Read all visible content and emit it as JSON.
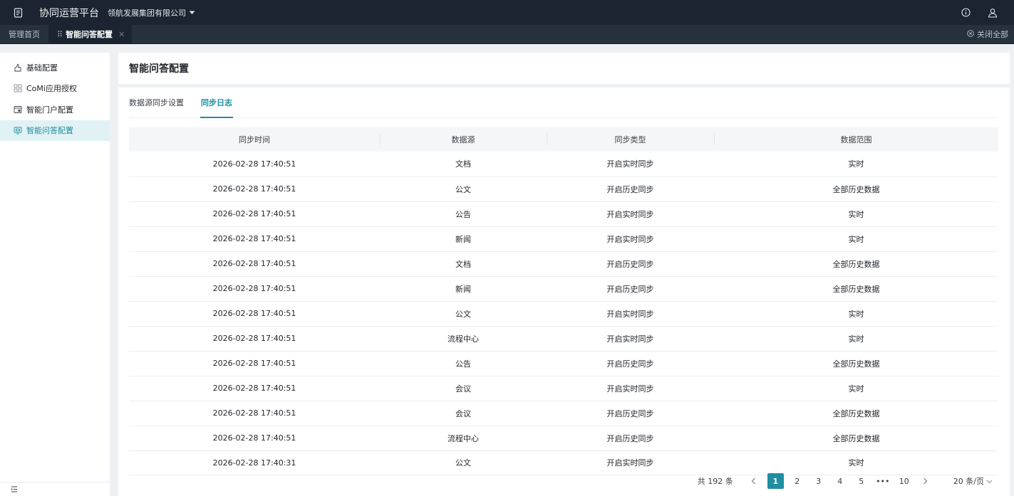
{
  "topbar": {
    "app_title": "协同运营平台",
    "company": "领航发展集团有限公司",
    "icons": [
      "app-icon",
      "info-icon",
      "user-icon"
    ]
  },
  "tabs": [
    {
      "label": "管理首页",
      "active": false
    },
    {
      "label": "智能问答配置",
      "active": true
    }
  ],
  "close_all_label": "关闭全部",
  "sidebar": {
    "items": [
      {
        "label": "基础配置",
        "icon": "hand-icon",
        "active": false
      },
      {
        "label": "CoMi应用授权",
        "icon": "grid-icon",
        "active": false
      },
      {
        "label": "智能门户配置",
        "icon": "portal-icon",
        "active": false
      },
      {
        "label": "智能问答配置",
        "icon": "qa-icon",
        "active": true
      }
    ]
  },
  "page_title": "智能问答配置",
  "subtabs": [
    {
      "label": "数据源同步设置",
      "active": false
    },
    {
      "label": "同步日志",
      "active": true
    }
  ],
  "table": {
    "headers": [
      "同步时间",
      "数据源",
      "同步类型",
      "数据范围"
    ],
    "rows": [
      [
        "2026-02-28 17:40:51",
        "文档",
        "开启实时同步",
        "实时"
      ],
      [
        "2026-02-28 17:40:51",
        "公文",
        "开启历史同步",
        "全部历史数据"
      ],
      [
        "2026-02-28 17:40:51",
        "公告",
        "开启实时同步",
        "实时"
      ],
      [
        "2026-02-28 17:40:51",
        "新闻",
        "开启实时同步",
        "实时"
      ],
      [
        "2026-02-28 17:40:51",
        "文档",
        "开启历史同步",
        "全部历史数据"
      ],
      [
        "2026-02-28 17:40:51",
        "新闻",
        "开启历史同步",
        "全部历史数据"
      ],
      [
        "2026-02-28 17:40:51",
        "公文",
        "开启实时同步",
        "实时"
      ],
      [
        "2026-02-28 17:40:51",
        "流程中心",
        "开启实时同步",
        "实时"
      ],
      [
        "2026-02-28 17:40:51",
        "公告",
        "开启历史同步",
        "全部历史数据"
      ],
      [
        "2026-02-28 17:40:51",
        "会议",
        "开启实时同步",
        "实时"
      ],
      [
        "2026-02-28 17:40:51",
        "会议",
        "开启历史同步",
        "全部历史数据"
      ],
      [
        "2026-02-28 17:40:51",
        "流程中心",
        "开启历史同步",
        "全部历史数据"
      ],
      [
        "2026-02-28 17:40:31",
        "公文",
        "开启实时同步",
        "实时"
      ]
    ]
  },
  "pagination": {
    "total_label": "共 192 条",
    "pages": [
      "1",
      "2",
      "3",
      "4",
      "5",
      "•••",
      "10"
    ],
    "current": "1",
    "page_size_label": "20 条/页"
  },
  "colors": {
    "accent": "#1f8ea0",
    "topbar_bg": "#1b2430",
    "tabstrip_bg": "#27313d",
    "active_side_bg": "#e1f2f4"
  }
}
